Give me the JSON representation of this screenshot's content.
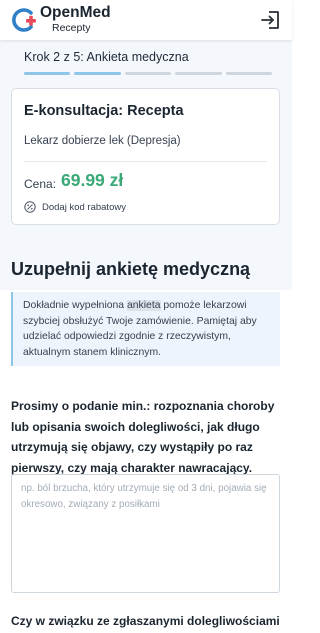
{
  "header": {
    "brand_name": "OpenMed",
    "brand_sub": "Recepty",
    "colors": {
      "logo_blue": "#2f80c8",
      "logo_red": "#e84c5a"
    }
  },
  "progress": {
    "step_label": "Krok 2 z 5: Ankieta medyczna",
    "current_step": 2,
    "total_steps": 5
  },
  "card": {
    "title": "E-konsultacja: Recepta",
    "description": "Lekarz dobierze lek (Depresja)",
    "price_label": "Cena:",
    "price_value": "69.99 zł",
    "discount_link": "Dodaj kod rabatowy",
    "colors": {
      "price": "#3aa877"
    }
  },
  "section": {
    "title": "Uzupełnij ankietę medyczną"
  },
  "info": {
    "text_before": "Dokładnie wypełniona ",
    "highlight": "ankieta",
    "text_after": " pomoże lekarzowi szybciej obsłużyć Twoje zamówienie. Pamiętaj aby udzielać odpowiedzi zgodnie z rzeczywistym, aktualnym stanem klinicznym."
  },
  "question1": {
    "text": "Prosimy o podanie min.: rozpoznania choroby lub opisania swoich dolegliwości, jak długo utrzymują się objawy, czy wystąpiły po raz pierwszy, czy mają charakter nawracający.",
    "value": "",
    "placeholder": "np. ból brzucha, który utrzymuje się od 3 dni, pojawia się okresowo, związany z posiłkami"
  },
  "question2": {
    "text": "Czy w związku ze zgłaszanymi dolegliwościami"
  },
  "icons": {
    "logo": "openmed-logo-icon",
    "logout": "logout-icon",
    "discount": "discount-icon"
  }
}
